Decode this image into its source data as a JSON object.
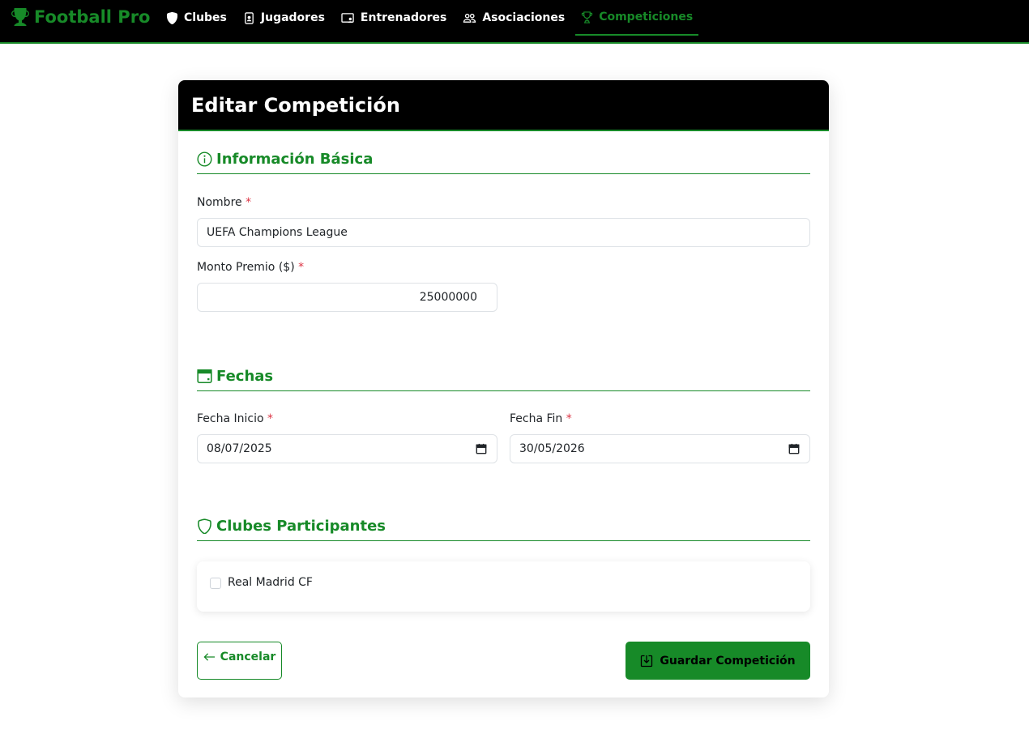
{
  "app": {
    "brand": "Football Pro"
  },
  "nav": {
    "items": [
      {
        "label": "Clubes",
        "icon": "shield-icon"
      },
      {
        "label": "Jugadores",
        "icon": "id-badge-icon"
      },
      {
        "label": "Entrenadores",
        "icon": "person-board-icon"
      },
      {
        "label": "Asociaciones",
        "icon": "people-icon"
      },
      {
        "label": "Competiciones",
        "icon": "trophy-icon",
        "active": true
      }
    ]
  },
  "form": {
    "title": "Editar Competición",
    "sections": {
      "basic": {
        "title": "Información Básica",
        "icon": "info-circle-icon"
      },
      "dates": {
        "title": "Fechas",
        "icon": "calendar-icon"
      },
      "clubs": {
        "title": "Clubes Participantes",
        "icon": "shield-outline-icon"
      }
    },
    "required_mark": "*",
    "fields": {
      "nombre": {
        "label": "Nombre",
        "value": "UEFA Champions League"
      },
      "monto": {
        "label": "Monto Premio ($)",
        "value": "25000000"
      },
      "fecha_inicio": {
        "label": "Fecha Inicio",
        "value": "08/07/2025"
      },
      "fecha_fin": {
        "label": "Fecha Fin",
        "value": "30/05/2026"
      }
    },
    "clubs": [
      {
        "name": "Real Madrid CF",
        "checked": false
      }
    ],
    "buttons": {
      "cancel": "Cancelar",
      "save": "Guardar Competición"
    }
  },
  "colors": {
    "accent": "#178a28",
    "header": "#000000",
    "required": "#dc3545"
  }
}
